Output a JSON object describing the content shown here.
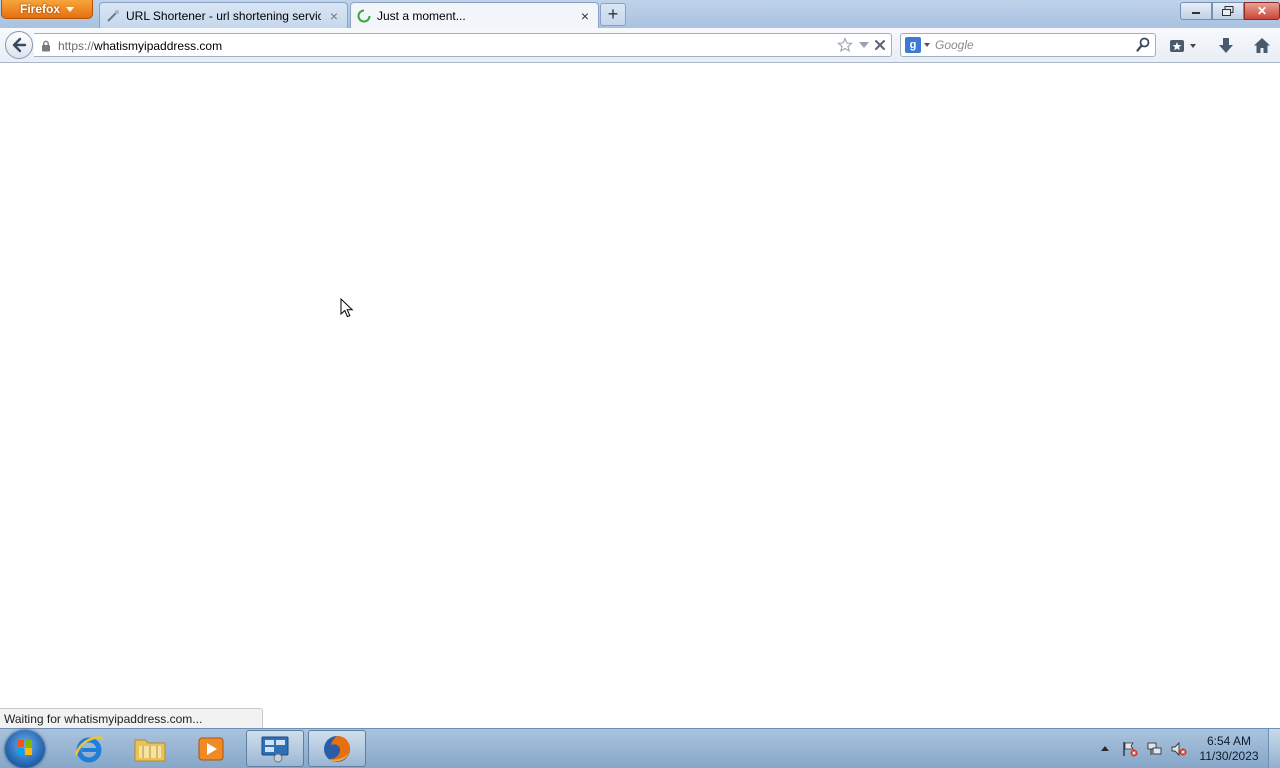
{
  "browser": {
    "menu_button_label": "Firefox",
    "tabs": [
      {
        "label": "URL Shortener - url shortening servic...",
        "close": "×",
        "active": false
      },
      {
        "label": "Just a moment...",
        "close": "×",
        "active": true
      }
    ],
    "new_tab_label": "+",
    "window_controls": {
      "close_label": "✕"
    }
  },
  "navbar": {
    "url_protocol": "https://",
    "url_host": "whatismyipaddress.com",
    "search_engine_letter": "g",
    "search_placeholder": "Google",
    "search_value": ""
  },
  "status": {
    "text": "Waiting for whatismyipaddress.com..."
  },
  "taskbar": {
    "apps": [
      "internet-explorer",
      "windows-explorer",
      "media-player",
      "remote-desktop",
      "firefox"
    ],
    "active_app": "firefox",
    "clock_time": "6:54 AM",
    "clock_date": "11/30/2023"
  },
  "colors": {
    "firefox_orange": "#e66f0f",
    "tab_strip": "#bfd3ea",
    "taskbar": "#86a7c9",
    "loading_spinner": "#3aa83a"
  }
}
